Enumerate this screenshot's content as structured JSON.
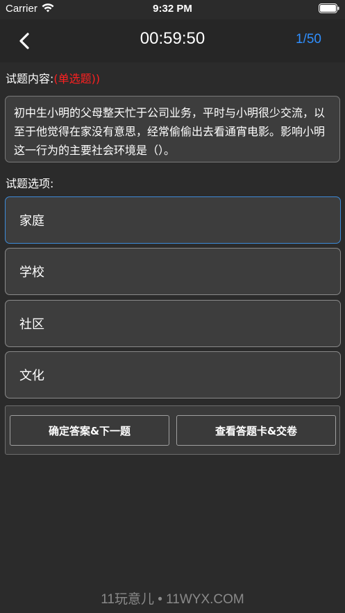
{
  "status_bar": {
    "carrier": "Carrier",
    "time": "9:32 PM"
  },
  "nav": {
    "timer": "00:59:50",
    "progress": "1/50",
    "accent_color": "#2f8fff"
  },
  "question": {
    "label": "试题内容:",
    "type": "(单选题))",
    "type_color": "#ff2020",
    "text": "初中生小明的父母整天忙于公司业务，平时与小明很少交流，以至于他觉得在家没有意思，经常偷偷出去看通宵电影。影响小明这一行为的主要社会环境是（）。"
  },
  "options": {
    "label": "试题选项:",
    "items": [
      {
        "label": "家庭",
        "selected": true
      },
      {
        "label": "学校",
        "selected": false
      },
      {
        "label": "社区",
        "selected": false
      },
      {
        "label": "文化",
        "selected": false
      }
    ]
  },
  "actions": {
    "confirm_next": "确定答案&下一题",
    "view_card_submit": "查看答题卡&交卷"
  },
  "watermark": "11玩意儿 • 11WYX.COM"
}
